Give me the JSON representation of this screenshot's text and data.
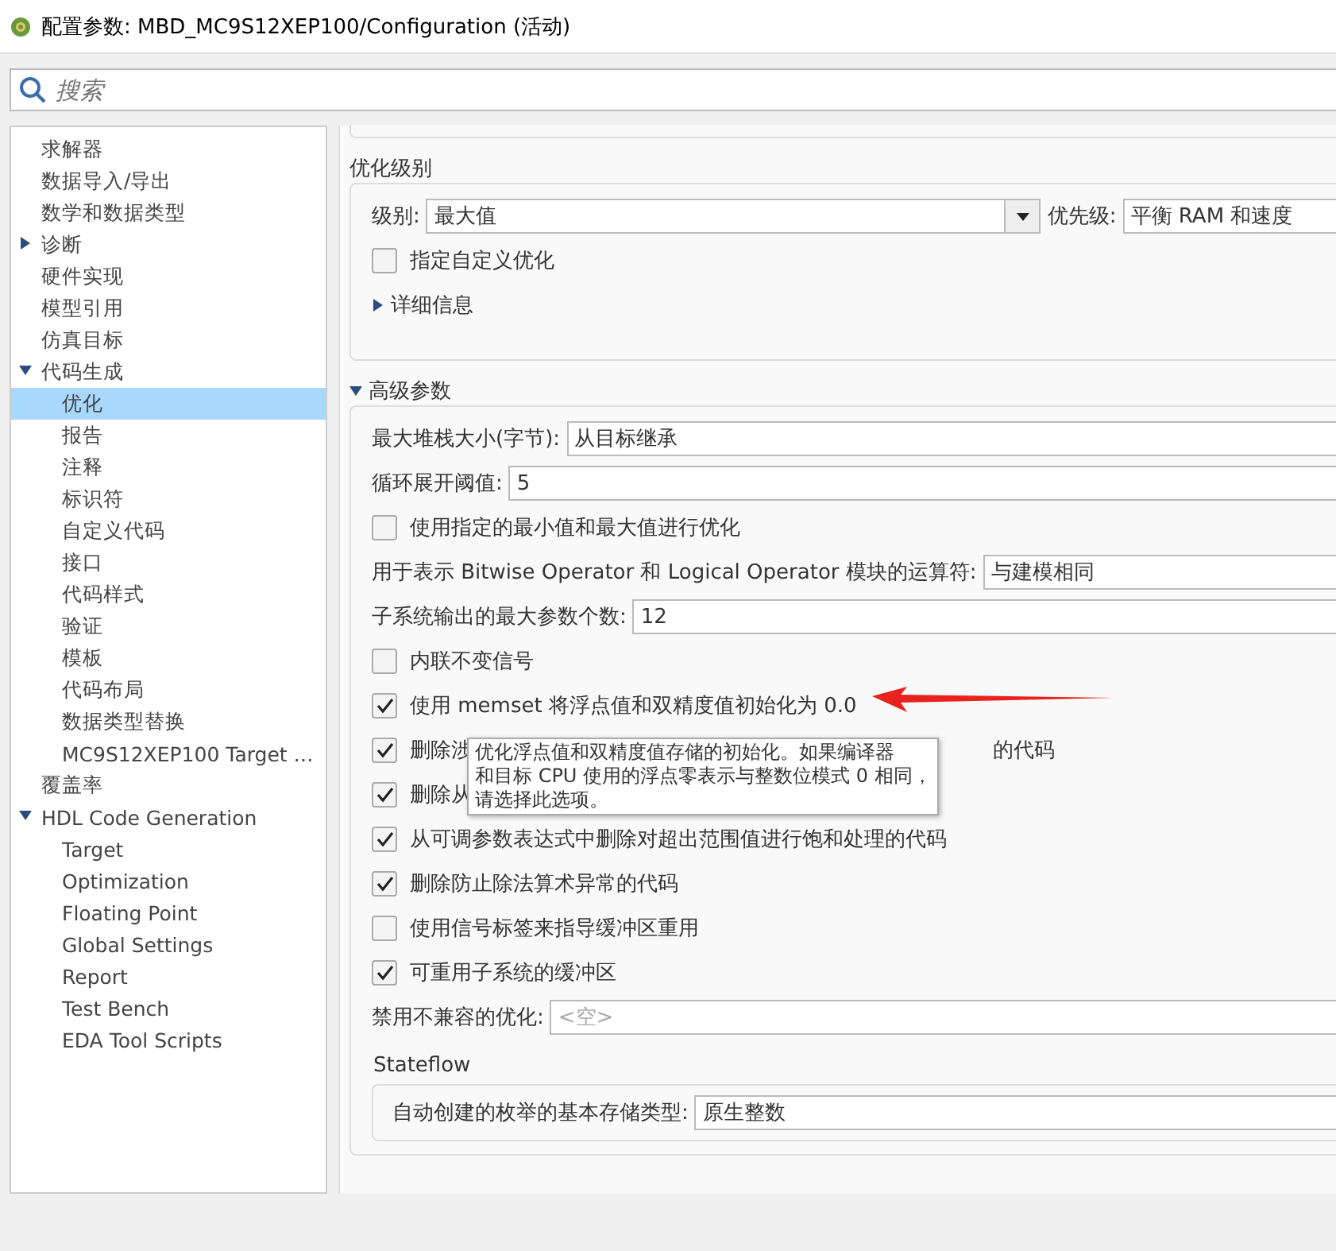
{
  "window": {
    "title": "配置参数: MBD_MC9S12XEP100/Configuration (活动)"
  },
  "search": {
    "placeholder": "搜索"
  },
  "sidebar": {
    "items": [
      {
        "label": "求解器",
        "selected": false
      },
      {
        "label": "数据导入/导出",
        "selected": false
      },
      {
        "label": "数学和数据类型",
        "selected": false
      },
      {
        "label": "诊断",
        "selected": false,
        "expanded": false
      },
      {
        "label": "硬件实现",
        "selected": false
      },
      {
        "label": "模型引用",
        "selected": false
      },
      {
        "label": "仿真目标",
        "selected": false
      },
      {
        "label": "代码生成",
        "selected": false,
        "expanded": true,
        "children": [
          {
            "label": "优化",
            "selected": true
          },
          {
            "label": "报告",
            "selected": false
          },
          {
            "label": "注释",
            "selected": false
          },
          {
            "label": "标识符",
            "selected": false
          },
          {
            "label": "自定义代码",
            "selected": false
          },
          {
            "label": "接口",
            "selected": false
          },
          {
            "label": "代码样式",
            "selected": false
          },
          {
            "label": "验证",
            "selected": false
          },
          {
            "label": "模板",
            "selected": false
          },
          {
            "label": "代码布局",
            "selected": false
          },
          {
            "label": "数据类型替换",
            "selected": false
          },
          {
            "label": "MC9S12XEP100 Target …",
            "selected": false
          }
        ]
      },
      {
        "label": "覆盖率",
        "selected": false
      },
      {
        "label": "HDL Code Generation",
        "selected": false,
        "expanded": true,
        "children": [
          {
            "label": "Target",
            "selected": false
          },
          {
            "label": "Optimization",
            "selected": false
          },
          {
            "label": "Floating Point",
            "selected": false
          },
          {
            "label": "Global Settings",
            "selected": false
          },
          {
            "label": "Report",
            "selected": false
          },
          {
            "label": "Test Bench",
            "selected": false
          },
          {
            "label": "EDA Tool Scripts",
            "selected": false
          }
        ]
      }
    ]
  },
  "optimization_level": {
    "heading": "优化级别",
    "level_label": "级别:",
    "level_value": "最大值",
    "priority_label": "优先级:",
    "priority_value": "平衡 RAM 和速度",
    "custom": {
      "label": "指定自定义优化",
      "checked": false
    },
    "details": {
      "label": "详细信息",
      "expanded": false
    }
  },
  "advanced": {
    "heading": "高级参数",
    "expanded": true,
    "rows": [
      {
        "kind": "field",
        "label": "最大堆栈大小(字节):",
        "value": "从目标继承"
      },
      {
        "kind": "field",
        "label": "循环展开阈值:",
        "value": "5"
      },
      {
        "kind": "checkbox",
        "label": "使用指定的最小值和最大值进行优化",
        "checked": false
      },
      {
        "kind": "field",
        "label": "用于表示 Bitwise Operator 和 Logical Operator 模块的运算符:",
        "value": "与建模相同"
      },
      {
        "kind": "field",
        "label": "子系统输出的最大参数个数:",
        "value": "12"
      },
      {
        "kind": "checkbox",
        "label": "内联不变信号",
        "checked": false
      },
      {
        "kind": "checkbox",
        "label": "使用 memset 将浮点值和双精度值初始化为 0.0",
        "checked": true
      },
      {
        "kind": "checkbox",
        "label": "删除涉",
        "label_tail": "的代码",
        "checked": true
      },
      {
        "kind": "checkbox",
        "label": "删除从",
        "checked": true
      },
      {
        "kind": "checkbox",
        "label": "从可调参数表达式中删除对超出范围值进行饱和处理的代码",
        "checked": true
      },
      {
        "kind": "checkbox",
        "label": "删除防止除法算术异常的代码",
        "checked": true
      },
      {
        "kind": "checkbox",
        "label": "使用信号标签来指导缓冲区重用",
        "checked": false
      },
      {
        "kind": "checkbox",
        "label": "可重用子系统的缓冲区",
        "checked": true
      },
      {
        "kind": "field",
        "label": "禁用不兼容的优化:",
        "placeholder": "<空>"
      }
    ],
    "stateflow": {
      "heading": "Stateflow",
      "rows": [
        {
          "kind": "field",
          "label": "自动创建的枚举的基本存储类型:",
          "value": "原生整数"
        }
      ]
    }
  },
  "tooltip": {
    "lines": [
      "优化浮点值和双精度值存储的初始化。如果编译器",
      "和目标 CPU 使用的浮点零表示与整数位模式 0 相同，",
      "请选择此选项。"
    ]
  }
}
